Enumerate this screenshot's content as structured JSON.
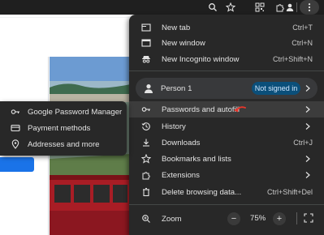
{
  "toolbar": {
    "icons": [
      "search-icon",
      "star-icon",
      "qr-code-icon",
      "extensions-icon",
      "profile-icon",
      "kebab-menu-icon"
    ]
  },
  "menu": {
    "items": [
      {
        "label": "New tab",
        "shortcut": "Ctrl+T",
        "icon": "new-tab-icon"
      },
      {
        "label": "New window",
        "shortcut": "Ctrl+N",
        "icon": "new-window-icon"
      },
      {
        "label": "New Incognito window",
        "shortcut": "Ctrl+Shift+N",
        "icon": "incognito-icon"
      }
    ],
    "profile": {
      "name": "Person 1",
      "status": "Not signed in",
      "icon": "person-icon"
    },
    "items2": [
      {
        "label": "Passwords and autofill",
        "shortcut": "",
        "icon": "key-icon",
        "submenu": true,
        "highlighted": true
      },
      {
        "label": "History",
        "shortcut": "",
        "icon": "history-icon",
        "submenu": true
      },
      {
        "label": "Downloads",
        "shortcut": "Ctrl+J",
        "icon": "download-icon"
      },
      {
        "label": "Bookmarks and lists",
        "shortcut": "",
        "icon": "bookmark-star-icon",
        "submenu": true
      },
      {
        "label": "Extensions",
        "shortcut": "",
        "icon": "puzzle-icon",
        "submenu": true
      },
      {
        "label": "Delete browsing data...",
        "shortcut": "Ctrl+Shift+Del",
        "icon": "trash-icon"
      }
    ],
    "zoom": {
      "label": "Zoom",
      "value": "75%",
      "minus": "−",
      "plus": "+",
      "icon": "zoom-icon"
    }
  },
  "submenu": {
    "items": [
      {
        "label": "Google Password Manager",
        "icon": "key-icon"
      },
      {
        "label": "Payment methods",
        "icon": "credit-card-icon"
      },
      {
        "label": "Addresses and more",
        "icon": "location-pin-icon"
      }
    ]
  },
  "colors": {
    "menu_bg": "#282828",
    "highlight": "#3c3c3c",
    "badge_bg": "#0b4f7a",
    "annotation_arrow": "#e8362b",
    "page_button": "#1a73e8"
  }
}
